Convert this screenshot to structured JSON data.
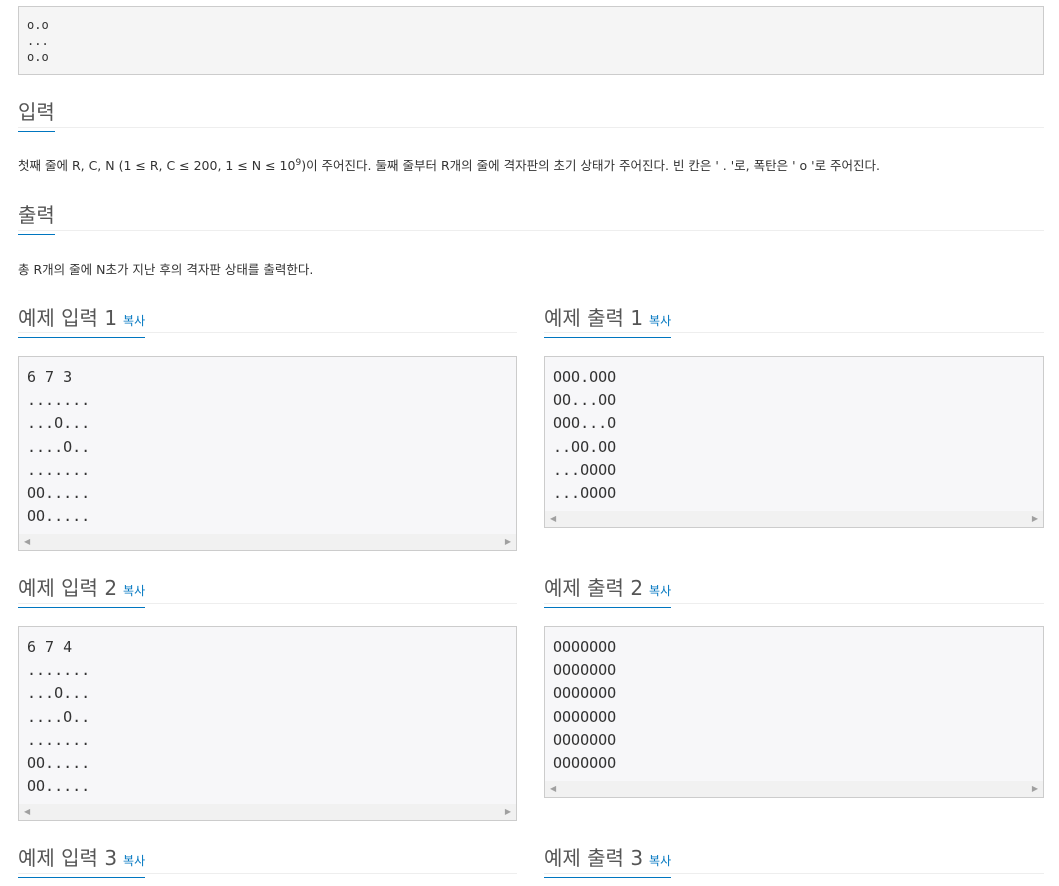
{
  "top_pre": {
    "lines": [
      "o.o",
      "...",
      "o.o"
    ]
  },
  "input_section": {
    "title": "입력",
    "text_part1": "첫째 줄에 R, C, N (1 ≤ R, C ≤ 200, 1 ≤ N ≤ 10",
    "exponent": "9",
    "text_part2": ")이 주어진다. 둘째 줄부터 R개의 줄에 격자판의 초기 상태가 주어진다. 빈 칸은 ' . '로, 폭탄은 ' o '로 주어진다."
  },
  "output_section": {
    "title": "출력",
    "text": "총 R개의 줄에 N초가 지난 후의 격자판 상태를 출력한다."
  },
  "copy_label": "복사",
  "samples": [
    {
      "input_title": "예제 입력 1",
      "output_title": "예제 출력 1",
      "input_lines": [
        "6 7 3",
        ".......",
        "...O...",
        "....O..",
        ".......",
        "OO.....",
        "OO....."
      ],
      "output_lines": [
        "OOO.OOO",
        "OO...OO",
        "OOO...O",
        "..OO.OO",
        "...OOOO",
        "...OOOO"
      ]
    },
    {
      "input_title": "예제 입력 2",
      "output_title": "예제 출력 2",
      "input_lines": [
        "6 7 4",
        ".......",
        "...O...",
        "....O..",
        ".......",
        "OO.....",
        "OO....."
      ],
      "output_lines": [
        "OOOOOOO",
        "OOOOOOO",
        "OOOOOOO",
        "OOOOOOO",
        "OOOOOOO",
        "OOOOOOO"
      ]
    },
    {
      "input_title": "예제 입력 3",
      "output_title": "예제 출력 3"
    }
  ]
}
